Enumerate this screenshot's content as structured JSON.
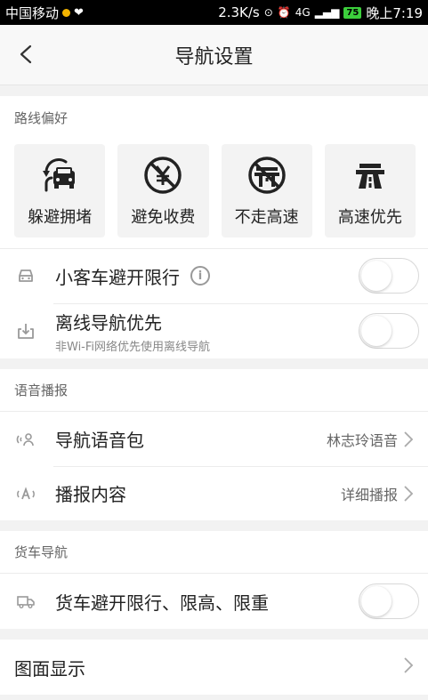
{
  "status_bar": {
    "carrier": "中国移动",
    "speed": "2.3K/s",
    "network": "4G",
    "battery": "75",
    "time": "晚上7:19"
  },
  "header": {
    "title": "导航设置"
  },
  "route_pref": {
    "heading": "路线偏好",
    "options": [
      {
        "label": "躲避拥堵",
        "icon": "avoid-congestion-icon"
      },
      {
        "label": "避免收费",
        "icon": "no-toll-icon"
      },
      {
        "label": "不走高速",
        "icon": "no-highway-icon"
      },
      {
        "label": "高速优先",
        "icon": "highway-first-icon"
      }
    ],
    "restrict_label": "小客车避开限行",
    "restrict_info": "i",
    "offline_label": "离线导航优先",
    "offline_sub": "非Wi-Fi网络优先使用离线导航"
  },
  "voice": {
    "heading": "语音播报",
    "pack_label": "导航语音包",
    "pack_value": "林志玲语音",
    "content_label": "播报内容",
    "content_value": "详细播报"
  },
  "truck": {
    "heading": "货车导航",
    "avoid_label": "货车避开限行、限高、限重"
  },
  "display": {
    "label": "图面显示"
  },
  "colors": {
    "accent_icon": "#222222",
    "toggle_off": "#ffffff",
    "background": "#f2f2f2"
  }
}
